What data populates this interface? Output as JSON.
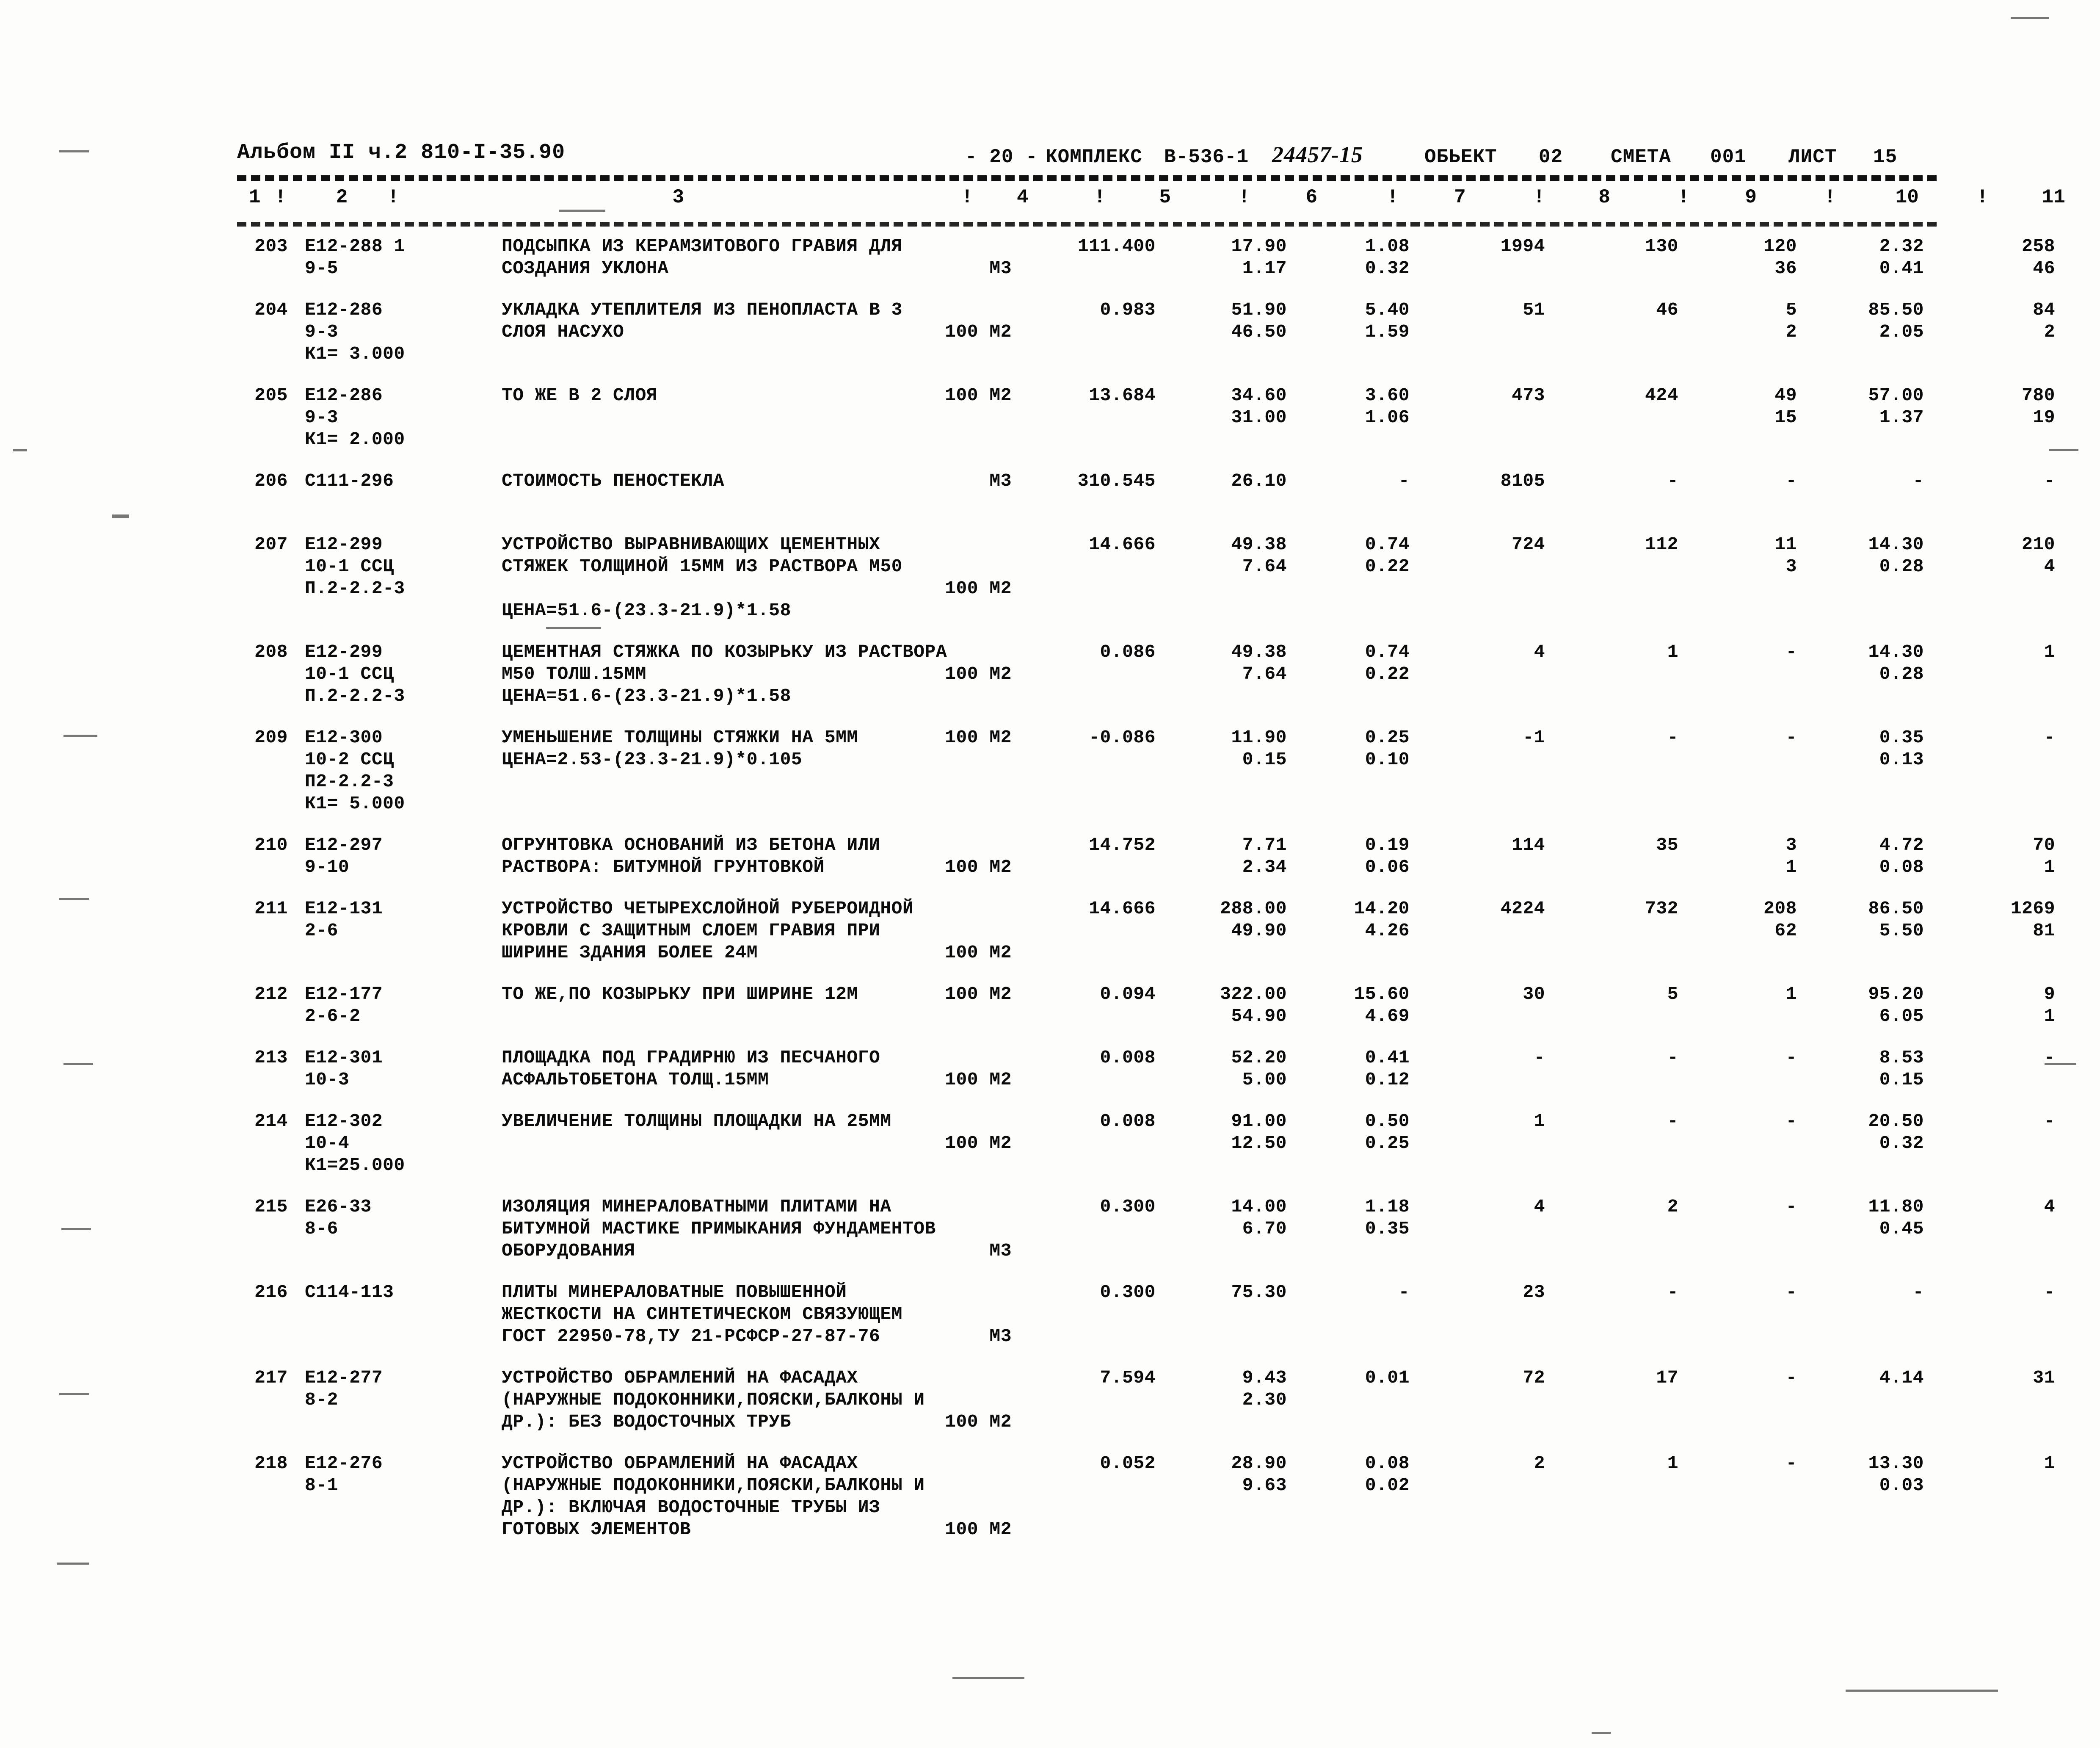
{
  "header": {
    "album": "Альбом II ч.2 810-I-35.90",
    "page_marker": "- 20 -",
    "complex_label": "КОМПЛЕКС",
    "complex_value": "В-536-1",
    "estimate_number": "24457-15",
    "object_label": "ОБЬЕКТ",
    "object_value": "02",
    "smeta_label": "СМЕТА",
    "smeta_value": "001",
    "list_label": "ЛИСТ",
    "list_value": "15"
  },
  "column_headers": [
    "1",
    "!",
    "2",
    "!",
    "3",
    "!",
    "4",
    "!",
    "5",
    "!",
    "6",
    "!",
    "7",
    "!",
    "8",
    "!",
    "9",
    "!",
    "10",
    "!",
    "11"
  ],
  "rows": [
    {
      "no": "203",
      "code": "E12-288 1",
      "sub": [
        "9-5"
      ],
      "desc": [
        "ПОДСЫПКА ИЗ КЕРАМЗИТОВОГО ГРАВИЯ ДЛЯ",
        "СОЗДАНИЯ УКЛОНА"
      ],
      "unit": "М3",
      "unit_line": 1,
      "c4": "111.400",
      "c5a": "17.90",
      "c5b": "1.17",
      "c6a": "1.08",
      "c6b": "0.32",
      "c7a": "1994",
      "c7b": "",
      "c8a": "130",
      "c8b": "",
      "c9a": "120",
      "c9b": "36",
      "c10a": "2.32",
      "c10b": "0.41",
      "c11a": "258",
      "c11b": "46"
    },
    {
      "no": "204",
      "code": "E12-286",
      "sub": [
        "9-3",
        "К1= 3.000"
      ],
      "desc": [
        "УКЛАДКА УТЕПЛИТЕЛЯ ИЗ ПЕНОПЛАСТА В 3",
        "СЛОЯ НАСУХО"
      ],
      "unit": "100 М2",
      "unit_line": 1,
      "c4": "0.983",
      "c5a": "51.90",
      "c5b": "46.50",
      "c6a": "5.40",
      "c6b": "1.59",
      "c7a": "51",
      "c7b": "",
      "c8a": "46",
      "c8b": "",
      "c9a": "5",
      "c9b": "2",
      "c10a": "85.50",
      "c10b": "2.05",
      "c11a": "84",
      "c11b": "2"
    },
    {
      "no": "205",
      "code": "E12-286",
      "sub": [
        "9-3",
        "К1= 2.000"
      ],
      "desc": [
        "ТО ЖЕ В 2 СЛОЯ"
      ],
      "unit": "100 М2",
      "unit_line": 0,
      "c4": "13.684",
      "c5a": "34.60",
      "c5b": "31.00",
      "c6a": "3.60",
      "c6b": "1.06",
      "c7a": "473",
      "c7b": "",
      "c8a": "424",
      "c8b": "",
      "c9a": "49",
      "c9b": "15",
      "c10a": "57.00",
      "c10b": "1.37",
      "c11a": "780",
      "c11b": "19"
    },
    {
      "no": "206",
      "code": "C111-296",
      "sub": [],
      "desc": [
        "СТОИМОСТЬ ПЕНОСТЕКЛА"
      ],
      "unit": "М3",
      "unit_line": 0,
      "c4": "310.545",
      "c5a": "26.10",
      "c5b": "",
      "c6a": "-",
      "c6b": "",
      "c7a": "8105",
      "c7b": "",
      "c8a": "-",
      "c8b": "",
      "c9a": "-",
      "c9b": "",
      "c10a": "-",
      "c10b": "",
      "c11a": "-",
      "c11b": ""
    },
    {
      "no": "207",
      "code": "E12-299",
      "sub": [
        "10-1 ССЦ",
        "П.2-2.2-3"
      ],
      "desc": [
        "УСТРОЙСТВО ВЫРАВНИВАЮЩИХ ЦЕМЕНТНЫХ",
        "СТЯЖЕК ТОЛЩИНОЙ 15ММ ИЗ РАСТВОРА М50"
      ],
      "formula": "ЦЕНА=51.6-(23.3-21.9)*1.58",
      "formula_line": 3,
      "unit": "100 М2",
      "unit_line": 2,
      "c4": "14.666",
      "c5a": "49.38",
      "c5b": "7.64",
      "c6a": "0.74",
      "c6b": "0.22",
      "c7a": "724",
      "c7b": "",
      "c8a": "112",
      "c8b": "",
      "c9a": "11",
      "c9b": "3",
      "c10a": "14.30",
      "c10b": "0.28",
      "c11a": "210",
      "c11b": "4"
    },
    {
      "no": "208",
      "code": "E12-299",
      "sub": [
        "10-1 ССЦ",
        "П.2-2.2-3"
      ],
      "desc": [
        "ЦЕМЕНТНАЯ СТЯЖКА ПО КОЗЫРЬКУ ИЗ РАСТВОРА",
        "М50 ТОЛШ.15ММ",
        "ЦЕНА=51.6-(23.3-21.9)*1.58"
      ],
      "unit": "100 М2",
      "unit_line": 1,
      "c4": "0.086",
      "c5a": "49.38",
      "c5b": "7.64",
      "c6a": "0.74",
      "c6b": "0.22",
      "c7a": "4",
      "c7b": "",
      "c8a": "1",
      "c8b": "",
      "c9a": "-",
      "c9b": "",
      "c10a": "14.30",
      "c10b": "0.28",
      "c11a": "1",
      "c11b": ""
    },
    {
      "no": "209",
      "code": "E12-300",
      "sub": [
        "10-2 ССЦ",
        "П2-2.2-3",
        "К1= 5.000"
      ],
      "desc": [
        "УМЕНЬШЕНИЕ ТОЛЩИНЫ СТЯЖКИ НА 5ММ",
        "ЦЕНА=2.53-(23.3-21.9)*0.105"
      ],
      "unit": "100 М2",
      "unit_line": 0,
      "c4": "-0.086",
      "c5a": "11.90",
      "c5b": "0.15",
      "c6a": "0.25",
      "c6b": "0.10",
      "c7a": "-1",
      "c7b": "",
      "c8a": "-",
      "c8b": "",
      "c9a": "-",
      "c9b": "",
      "c10a": "0.35",
      "c10b": "0.13",
      "c11a": "-",
      "c11b": ""
    },
    {
      "no": "210",
      "code": "E12-297",
      "sub": [
        "9-10"
      ],
      "desc": [
        "ОГРУНТОВКА ОСНОВАНИЙ ИЗ БЕТОНА ИЛИ",
        "РАСТВОРА: БИТУМНОЙ ГРУНТОВКОЙ"
      ],
      "unit": "100 М2",
      "unit_line": 1,
      "c4": "14.752",
      "c5a": "7.71",
      "c5b": "2.34",
      "c6a": "0.19",
      "c6b": "0.06",
      "c7a": "114",
      "c7b": "",
      "c8a": "35",
      "c8b": "",
      "c9a": "3",
      "c9b": "1",
      "c10a": "4.72",
      "c10b": "0.08",
      "c11a": "70",
      "c11b": "1"
    },
    {
      "no": "211",
      "code": "E12-131",
      "sub": [
        "2-6"
      ],
      "desc": [
        "УСТРОЙСТВО ЧЕТЫРЕХСЛОЙНОЙ РУБЕРОИДНОЙ",
        "КРОВЛИ С ЗАЩИТНЫМ СЛОЕМ ГРАВИЯ ПРИ",
        "ШИРИНЕ ЗДАНИЯ БОЛЕЕ 24М"
      ],
      "unit": "100 М2",
      "unit_line": 2,
      "c4": "14.666",
      "c5a": "288.00",
      "c5b": "49.90",
      "c6a": "14.20",
      "c6b": "4.26",
      "c7a": "4224",
      "c7b": "",
      "c8a": "732",
      "c8b": "",
      "c9a": "208",
      "c9b": "62",
      "c10a": "86.50",
      "c10b": "5.50",
      "c11a": "1269",
      "c11b": "81"
    },
    {
      "no": "212",
      "code": "E12-177",
      "sub": [
        "2-6-2"
      ],
      "desc": [
        "ТО ЖЕ,ПО КОЗЫРЬКУ ПРИ ШИРИНЕ 12М"
      ],
      "unit": "100 М2",
      "unit_line": 0,
      "c4": "0.094",
      "c5a": "322.00",
      "c5b": "54.90",
      "c6a": "15.60",
      "c6b": "4.69",
      "c7a": "30",
      "c7b": "",
      "c8a": "5",
      "c8b": "",
      "c9a": "1",
      "c9b": "",
      "c10a": "95.20",
      "c10b": "6.05",
      "c11a": "9",
      "c11b": "1"
    },
    {
      "no": "213",
      "code": "E12-301",
      "sub": [
        "10-3"
      ],
      "desc": [
        "ПЛОЩАДКА ПОД ГРАДИРНЮ ИЗ ПЕСЧАНОГО",
        "АСФАЛЬТОБЕТОНА ТОЛЩ.15ММ"
      ],
      "unit": "100 М2",
      "unit_line": 1,
      "c4": "0.008",
      "c5a": "52.20",
      "c5b": "5.00",
      "c6a": "0.41",
      "c6b": "0.12",
      "c7a": "-",
      "c7b": "",
      "c8a": "-",
      "c8b": "",
      "c9a": "-",
      "c9b": "",
      "c10a": "8.53",
      "c10b": "0.15",
      "c11a": "-",
      "c11b": ""
    },
    {
      "no": "214",
      "code": "E12-302",
      "sub": [
        "10-4",
        "К1=25.000"
      ],
      "desc": [
        "УВЕЛИЧЕНИЕ ТОЛЩИНЫ ПЛОЩАДКИ НА 25ММ"
      ],
      "unit": "100 М2",
      "unit_line": 1,
      "c4": "0.008",
      "c5a": "91.00",
      "c5b": "12.50",
      "c6a": "0.50",
      "c6b": "0.25",
      "c7a": "1",
      "c7b": "",
      "c8a": "-",
      "c8b": "",
      "c9a": "-",
      "c9b": "",
      "c10a": "20.50",
      "c10b": "0.32",
      "c11a": "-",
      "c11b": ""
    },
    {
      "no": "215",
      "code": "E26-33",
      "sub": [
        "8-6"
      ],
      "desc": [
        "ИЗОЛЯЦИЯ МИНЕРАЛОВАТНЫМИ ПЛИТАМИ НА",
        "БИТУМНОЙ МАСТИКЕ ПРИМЫКАНИЯ ФУНДАМЕНТОВ",
        "ОБОРУДОВАНИЯ"
      ],
      "unit": "М3",
      "unit_line": 2,
      "c4": "0.300",
      "c5a": "14.00",
      "c5b": "6.70",
      "c6a": "1.18",
      "c6b": "0.35",
      "c7a": "4",
      "c7b": "",
      "c8a": "2",
      "c8b": "",
      "c9a": "-",
      "c9b": "",
      "c10a": "11.80",
      "c10b": "0.45",
      "c11a": "4",
      "c11b": ""
    },
    {
      "no": "216",
      "code": "C114-113",
      "sub": [],
      "desc": [
        "ПЛИТЫ МИНЕРАЛОВАТНЫЕ ПОВЫШЕННОЙ",
        "ЖЕСТКОСТИ НА СИНТЕТИЧЕСКОМ СВЯЗУЮЩЕМ",
        "ГОСТ 22950-78,ТУ 21-РСФСР-27-87-76"
      ],
      "unit": "М3",
      "unit_line": 2,
      "c4": "0.300",
      "c5a": "75.30",
      "c5b": "",
      "c6a": "-",
      "c6b": "",
      "c7a": "23",
      "c7b": "",
      "c8a": "-",
      "c8b": "",
      "c9a": "-",
      "c9b": "",
      "c10a": "-",
      "c10b": "",
      "c11a": "-",
      "c11b": ""
    },
    {
      "no": "217",
      "code": "E12-277",
      "sub": [
        "8-2"
      ],
      "desc": [
        "УСТРОЙСТВО ОБРАМЛЕНИЙ НА ФАСАДАХ",
        "(НАРУЖНЫЕ ПОДОКОННИКИ,ПОЯСКИ,БАЛКОНЫ И",
        "ДР.): БЕЗ ВОДОСТОЧНЫХ ТРУБ"
      ],
      "unit": "100 М2",
      "unit_line": 2,
      "c4": "7.594",
      "c5a": "9.43",
      "c5b": "2.30",
      "c6a": "0.01",
      "c6b": "",
      "c7a": "72",
      "c7b": "",
      "c8a": "17",
      "c8b": "",
      "c9a": "-",
      "c9b": "",
      "c10a": "4.14",
      "c10b": "",
      "c11a": "31",
      "c11b": ""
    },
    {
      "no": "218",
      "code": "E12-276",
      "sub": [
        "8-1"
      ],
      "desc": [
        "УСТРОЙСТВО ОБРАМЛЕНИЙ НА ФАСАДАХ",
        "(НАРУЖНЫЕ ПОДОКОННИКИ,ПОЯСКИ,БАЛКОНЫ И",
        "ДР.): ВКЛЮЧАЯ ВОДОСТОЧНЫЕ ТРУБЫ ИЗ",
        "ГОТОВЫХ ЭЛЕМЕНТОВ"
      ],
      "unit": "100 М2",
      "unit_line": 3,
      "c4": "0.052",
      "c5a": "28.90",
      "c5b": "9.63",
      "c6a": "0.08",
      "c6b": "0.02",
      "c7a": "2",
      "c7b": "",
      "c8a": "1",
      "c8b": "",
      "c9a": "-",
      "c9b": "",
      "c10a": "13.30",
      "c10b": "0.03",
      "c11a": "1",
      "c11b": ""
    }
  ]
}
